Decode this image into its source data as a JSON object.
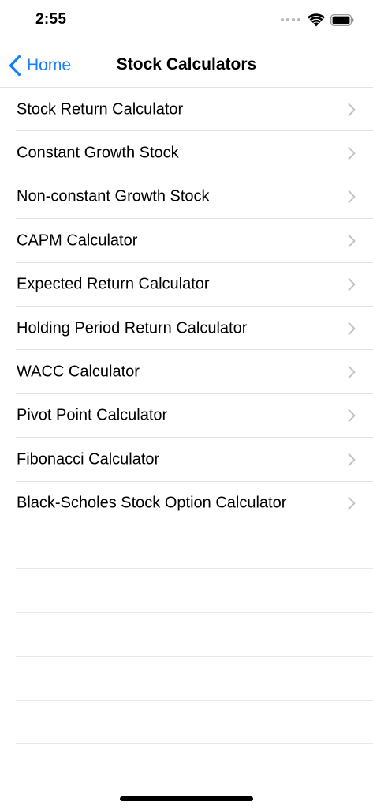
{
  "status_bar": {
    "time": "2:55",
    "icons": [
      "signal-dots-icon",
      "wifi-icon",
      "battery-icon"
    ]
  },
  "nav": {
    "back_label": "Home",
    "title": "Stock Calculators"
  },
  "list": {
    "items": [
      {
        "label": "Stock Return Calculator"
      },
      {
        "label": "Constant Growth Stock"
      },
      {
        "label": "Non-constant Growth Stock"
      },
      {
        "label": "CAPM Calculator"
      },
      {
        "label": "Expected Return Calculator"
      },
      {
        "label": "Holding Period Return Calculator"
      },
      {
        "label": "WACC Calculator"
      },
      {
        "label": "Pivot Point Calculator"
      },
      {
        "label": "Fibonacci Calculator"
      },
      {
        "label": "Black-Scholes Stock Option Calculator"
      }
    ]
  },
  "colors": {
    "accent": "#147efb",
    "separator": "#e2e2e4",
    "chevron": "#c4c4c7"
  }
}
